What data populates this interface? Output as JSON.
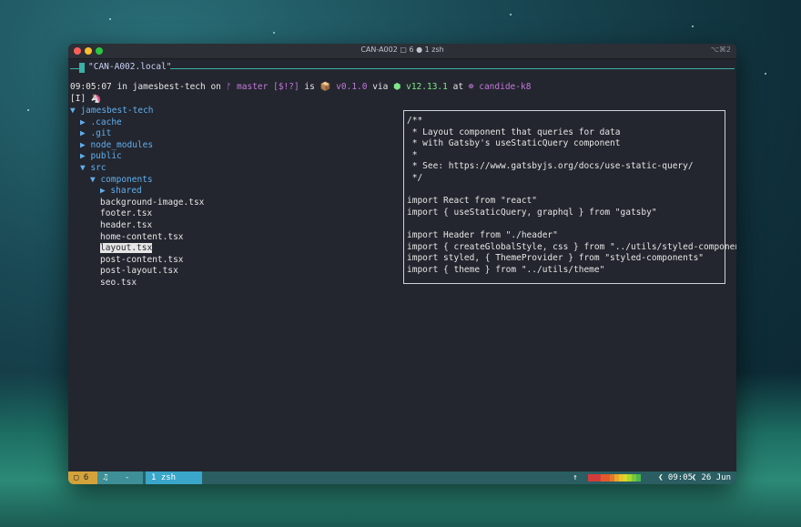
{
  "window": {
    "title": "CAN-A002 ▢ 6 ● 1 zsh",
    "title_right": "⌥⌘2"
  },
  "tab": {
    "label": "\"CAN-A002.local\""
  },
  "prompt": {
    "time": "09:05:07",
    "in": " in ",
    "user": "jamesbest-tech",
    "on": " on ",
    "branch_icon": "ᚠ",
    "branch": " master",
    "status": " [$!?]",
    "is": " is ",
    "pkg_icon": "📦",
    "version": " v0.1.0",
    "via": " via ",
    "node_icon": "⬢",
    "node_version": " v12.13.1",
    "at": " at ",
    "k8_icon": "☸",
    "k8": " candide-k8"
  },
  "mode_line": "[I] 🦄",
  "tree": [
    {
      "indent": 0,
      "text": "▼ jamesbest-tech",
      "type": "dir"
    },
    {
      "indent": 1,
      "text": "▶ .cache",
      "type": "dir"
    },
    {
      "indent": 1,
      "text": "▶ .git",
      "type": "dir"
    },
    {
      "indent": 1,
      "text": "▶ node_modules",
      "type": "dir"
    },
    {
      "indent": 1,
      "text": "▶ public",
      "type": "dir"
    },
    {
      "indent": 1,
      "text": "▼ src",
      "type": "dir"
    },
    {
      "indent": 2,
      "text": "▼ components",
      "type": "dir"
    },
    {
      "indent": 3,
      "text": "▶ shared",
      "type": "dir"
    },
    {
      "indent": 3,
      "text": "background-image.tsx",
      "type": "file"
    },
    {
      "indent": 3,
      "text": "footer.tsx",
      "type": "file"
    },
    {
      "indent": 3,
      "text": "header.tsx",
      "type": "file"
    },
    {
      "indent": 3,
      "text": "home-content.tsx",
      "type": "file"
    },
    {
      "indent": 3,
      "text": "layout.tsx",
      "type": "file",
      "selected": true
    },
    {
      "indent": 3,
      "text": "post-content.tsx",
      "type": "file"
    },
    {
      "indent": 3,
      "text": "post-layout.tsx",
      "type": "file"
    },
    {
      "indent": 3,
      "text": "seo.tsx",
      "type": "file"
    }
  ],
  "preview": [
    "/**",
    " * Layout component that queries for data",
    " * with Gatsby's useStaticQuery component",
    " *",
    " * See: https://www.gatsbyjs.org/docs/use-static-query/",
    " */",
    "",
    "import React from \"react\"",
    "import { useStaticQuery, graphql } from \"gatsby\"",
    "",
    "import Header from \"./header\"",
    "import { createGlobalStyle, css } from \"../utils/styled-componen",
    "import styled, { ThemeProvider } from \"styled-components\"",
    "import { theme } from \"../utils/theme\""
  ],
  "statusbar": {
    "session": "▢ 6",
    "music": "♫",
    "dash": "-",
    "window": "1 zsh",
    "up": "↑",
    "time": "❮ 09:05",
    "date": "❮ 26 Jun"
  },
  "colors": {
    "accent": "#3bb0a8",
    "status_bg": "#2a5e63",
    "session_bg": "#d4a23a",
    "window_bg": "#3aa6c9"
  }
}
